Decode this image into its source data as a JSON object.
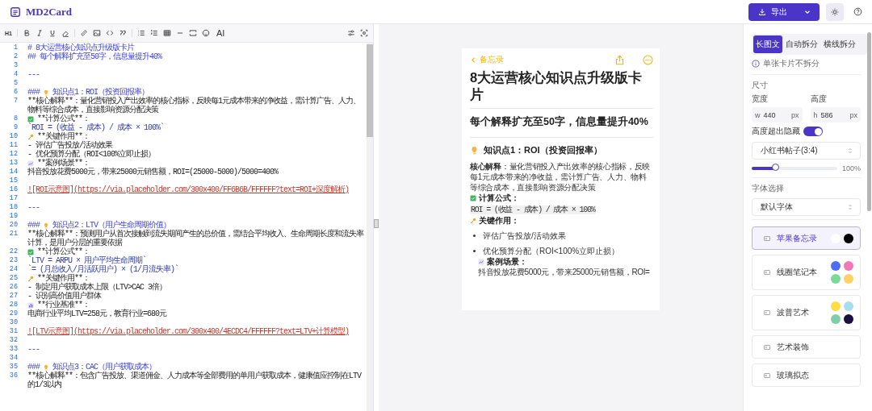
{
  "header": {
    "app_name": "MD2Card",
    "export_button": "导出"
  },
  "toolbar": {
    "heading_button": "H1",
    "ai_button": "AI"
  },
  "editor": {
    "lines": [
      {
        "n": "1",
        "kind": "heading",
        "text": "# 8大运营核心知识点升级版卡片"
      },
      {
        "n": "2",
        "kind": "heading",
        "text": "## 每个解释扩充至50字，信息量提升40%"
      },
      {
        "n": "3",
        "kind": "blank"
      },
      {
        "n": "4",
        "kind": "rule",
        "text": "---"
      },
      {
        "n": "5",
        "kind": "blank"
      },
      {
        "n": "6",
        "kind": "tip_heading",
        "prefix": "###",
        "text": "知识点1：ROI（投资回报率）"
      },
      {
        "n": "7",
        "kind": "text",
        "text": "**核心解释**：量化营销投入产出效率的核心指标，反映每1元成本带来的净收益，需计算广告、人力、物料等综合成本，直接影响资源分配决策"
      },
      {
        "n": "8",
        "kind": "formula_label",
        "text": "**计算公式**："
      },
      {
        "n": "9",
        "kind": "code",
        "text": "`ROI = (收益 - 成本) / 成本 × 100%`"
      },
      {
        "n": "10",
        "kind": "role_label",
        "text": "**关键作用**："
      },
      {
        "n": "11",
        "kind": "text",
        "text": "- 评估广告投放/活动效果"
      },
      {
        "n": "12",
        "kind": "text",
        "text": "- 优化预算分配（ROI<100%立即止损）"
      },
      {
        "n": "13",
        "kind": "case_label",
        "text": "**案例场景**："
      },
      {
        "n": "14",
        "kind": "text",
        "text": "抖音投放花费5000元，带来25000元销售额，ROI=(25000-5000)/5000=400%"
      },
      {
        "n": "15",
        "kind": "blank"
      },
      {
        "n": "16",
        "kind": "link",
        "text": "![ROI示意图](https://via.placeholder.com/300x400/FF6B6B/FFFFFF?text=ROI+深度解析)"
      },
      {
        "n": "17",
        "kind": "blank"
      },
      {
        "n": "18",
        "kind": "rule",
        "text": "---"
      },
      {
        "n": "19",
        "kind": "blank"
      },
      {
        "n": "20",
        "kind": "tip_heading",
        "prefix": "###",
        "text": "知识点2：LTV（用户生命周期价值）"
      },
      {
        "n": "21",
        "kind": "text",
        "text": "**核心解释**：预测用户从首次接触到流失期间产生的总价值，需结合平均收入、生命周期长度和流失率计算，是用户分层的重要依据"
      },
      {
        "n": "22",
        "kind": "formula_label",
        "text": "**计算公式**："
      },
      {
        "n": "23",
        "kind": "code",
        "text": "`LTV = ARPU × 用户平均生命周期`"
      },
      {
        "n": "24",
        "kind": "code",
        "text": "`= (月总收入/月活跃用户) × (1/月流失率)`"
      },
      {
        "n": "25",
        "kind": "role_label",
        "text": "**关键作用**："
      },
      {
        "n": "26",
        "kind": "text",
        "text": "- 制定用户获取成本上限（LTV>CAC 3倍）"
      },
      {
        "n": "27",
        "kind": "text",
        "text": "- 识别高价值用户群体"
      },
      {
        "n": "28",
        "kind": "benchmark_label",
        "text": "**行业基准**："
      },
      {
        "n": "29",
        "kind": "text",
        "text": "电商行业平均LTV=258元，教育行业=680元"
      },
      {
        "n": "30",
        "kind": "blank"
      },
      {
        "n": "31",
        "kind": "link",
        "text": "![LTV示意图](https://via.placeholder.com/300x400/4ECDC4/FFFFFF?text=LTV+计算模型)"
      },
      {
        "n": "32",
        "kind": "blank"
      },
      {
        "n": "33",
        "kind": "rule",
        "text": "---"
      },
      {
        "n": "34",
        "kind": "blank"
      },
      {
        "n": "35",
        "kind": "tip_heading",
        "prefix": "###",
        "text": "知识点3：CAC（用户获取成本）"
      },
      {
        "n": "36",
        "kind": "text",
        "text": "**核心解释**：包含广告投放、渠道佣金、人力成本等全部费用的单用户获取成本，健康值应控制在LTV的1/3以内"
      }
    ]
  },
  "preview": {
    "back_label": "备忘录",
    "title": "8大运营核心知识点升级版卡片",
    "subtitle": "每个解释扩充至50字，信息量提升40%",
    "section_title": "知识点1：ROI（投资回报率）",
    "explanation": "**核心解释**：量化营销投入产出效率的核心指标，反映每1元成本带来的净收益，需计算广告、人力、物料等综合成本，直接影响资源分配决策",
    "formula_label": "计算公式：",
    "formula": "ROI = (收益 - 成本) / 成本 × 100%",
    "role_label": "关键作用：",
    "bullets": [
      "评估广告投放/活动效果",
      "优化预算分配（ROI<100%立即止损）"
    ],
    "case_label": "案例场景：",
    "case_text": "抖音投放花费5000元，带来25000元销售额，ROI="
  },
  "settings": {
    "split_tabs": [
      {
        "label": "长图文",
        "selected": true
      },
      {
        "label": "自动拆分",
        "selected": false
      },
      {
        "label": "横线拆分",
        "selected": false
      }
    ],
    "split_note": "单张卡片不拆分",
    "size_label": "尺寸",
    "width": {
      "label": "宽度",
      "prefix": "w",
      "value": "440",
      "unit": "px"
    },
    "height": {
      "label": "高度",
      "prefix": "h",
      "value": "586",
      "unit": "px"
    },
    "overflow_toggle": {
      "label": "高度超出隐藏",
      "on": true
    },
    "preset_select": {
      "value": "小红书帖子(3:4)"
    },
    "zoom": {
      "level": 0.28,
      "reading": "100%"
    },
    "font_label": "字体选择",
    "font_select": {
      "value": "默认字体"
    },
    "themes": [
      {
        "name": "苹果备忘录",
        "selected": true,
        "swatches": [
          {
            "color": "#ffffff"
          },
          {
            "color": "#000000"
          }
        ]
      },
      {
        "name": "线圈笔记本",
        "selected": false,
        "swatches": [
          {
            "color": "#4f6ef7"
          },
          {
            "color": "#f178b6"
          },
          {
            "color": "#7dd99a"
          },
          {
            "color": "#ffd166"
          }
        ]
      },
      {
        "name": "波普艺术",
        "selected": false,
        "swatches": [
          {
            "color": "#ffdd44"
          },
          {
            "color": "#a8ddef"
          },
          {
            "color": "#7ecfa8"
          },
          {
            "color": "#1a1040"
          }
        ]
      },
      {
        "name": "艺术装饰",
        "selected": false
      },
      {
        "name": "玻璃拟态",
        "selected": false
      }
    ]
  }
}
